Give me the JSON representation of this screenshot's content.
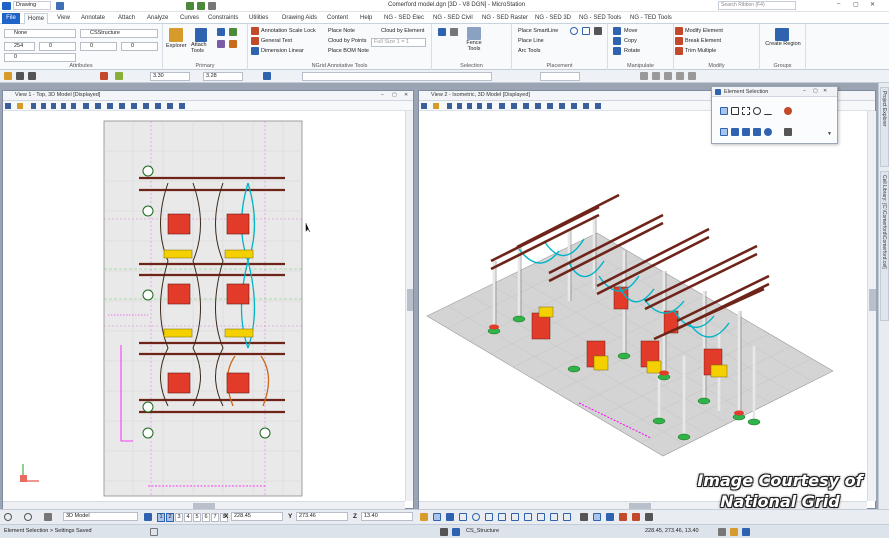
{
  "app": {
    "title": "Comerford model.dgn [3D - V8 DGN] - MicroStation",
    "workflow": "Drawing",
    "search_placeholder": "Search Ribbon (F4)"
  },
  "tabs": [
    "File",
    "Home",
    "View",
    "Annotate",
    "Attach",
    "Analyze",
    "Curves",
    "Constraints",
    "Utilities",
    "Drawing Aids",
    "Content",
    "Help",
    "NG - SED Elec",
    "NG - SED Civil",
    "NG - SED Raster",
    "NG - SED 3D",
    "NG - SED Tools",
    "NG - TED Tools"
  ],
  "ribbon": {
    "attributes": {
      "level": "None",
      "style": "CSStructure",
      "color": "254",
      "weight_a": "0",
      "weight_b": "0",
      "weight_c": "0",
      "weight_d": "0",
      "label": "Attributes"
    },
    "primary": {
      "explorer": "Explorer",
      "attach_tools": "Attach Tools",
      "label": "Primary"
    },
    "annotative": {
      "items": [
        "Annotation Scale Lock",
        "General Text",
        "Dimension Linear",
        "Place Note",
        "Cloud by Points",
        "Place BOM Note",
        "Cloud by Element"
      ],
      "scale_value": "Full Size 1 = 1",
      "label": "NGrid Annotative Tools"
    },
    "selection": {
      "fence": "Fence Tools",
      "label": "Selection"
    },
    "placement": {
      "items": [
        "Place SmartLine",
        "Place Line",
        "Arc Tools"
      ],
      "label": "Placement"
    },
    "manipulate": {
      "items": [
        "Move",
        "Copy",
        "Rotate"
      ],
      "label": "Manipulate"
    },
    "modify": {
      "items": [
        "Modify Element",
        "Break Element",
        "Trim Multiple"
      ],
      "label": "Modify"
    },
    "groups": {
      "create_region": "Create Region",
      "label": "Groups"
    }
  },
  "attrbar": {
    "value_a": "3.30",
    "value_b": "3.28"
  },
  "views": {
    "view1": {
      "title": "View 1 - Top, 3D Model [Displayed]"
    },
    "view2": {
      "title": "View 2 - Isometric, 3D Model [Displayed]"
    }
  },
  "element_selection": {
    "title": "Element Selection"
  },
  "right_dock": [
    "Project Explorer",
    "Cell Library: [C:\\Comerford\\Comerford.cel]"
  ],
  "viewbar": {
    "model": "3D Model",
    "view_buttons": [
      "1",
      "2",
      "3",
      "4",
      "5",
      "6",
      "7",
      "8"
    ],
    "x_label": "X",
    "x_value": "228.45",
    "y_label": "Y",
    "y_value": "273.46",
    "z_label": "Z",
    "z_value": "13.40"
  },
  "status": {
    "message": "Element Selection > Settings Saved",
    "level": "CS_Structure",
    "coords": "228.45, 273.46, 13.40"
  },
  "credit": {
    "line1": "Image Courtesy of",
    "line2": "National Grid"
  },
  "colors": {
    "accent": "#1e64c8",
    "level_red": "#e23b2a",
    "level_yellow": "#f4d000",
    "level_cyan": "#00b4c8",
    "steel_dark": "#6e2418",
    "bg_grid": "#c9c9c9"
  }
}
